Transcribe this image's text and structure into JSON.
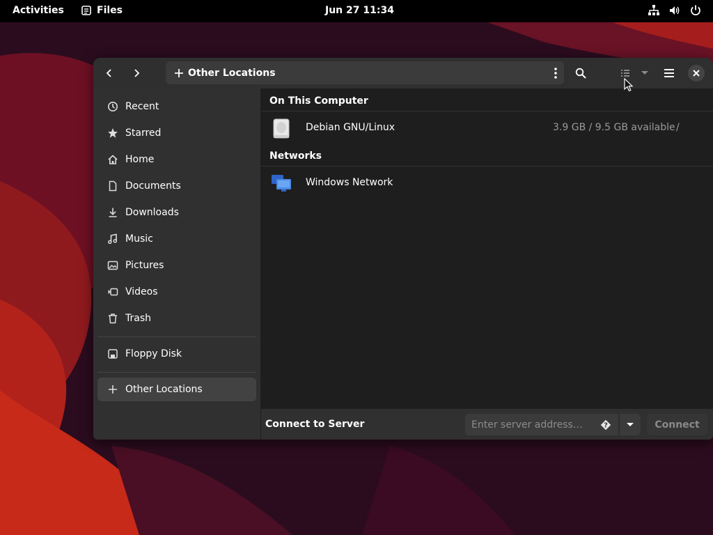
{
  "topbar": {
    "activities": "Activities",
    "app_name": "Files",
    "clock": "Jun 27  11:34",
    "icons": [
      "network-icon",
      "volume-icon",
      "power-icon"
    ]
  },
  "window": {
    "path_label": "Other Locations",
    "sidebar": {
      "items": [
        {
          "label": "Recent",
          "icon": "clock-icon"
        },
        {
          "label": "Starred",
          "icon": "star-icon"
        },
        {
          "label": "Home",
          "icon": "home-icon"
        },
        {
          "label": "Documents",
          "icon": "document-icon"
        },
        {
          "label": "Downloads",
          "icon": "download-icon"
        },
        {
          "label": "Music",
          "icon": "music-icon"
        },
        {
          "label": "Pictures",
          "icon": "picture-icon"
        },
        {
          "label": "Videos",
          "icon": "video-icon"
        },
        {
          "label": "Trash",
          "icon": "trash-icon"
        }
      ],
      "devices": [
        {
          "label": "Floppy Disk",
          "icon": "floppy-icon"
        }
      ],
      "other": {
        "label": "Other Locations",
        "icon": "plus-icon",
        "active": true
      }
    },
    "sections": {
      "computer": {
        "title": "On This Computer",
        "items": [
          {
            "name": "Debian GNU/Linux",
            "availability": "3.9 GB / 9.5 GB available",
            "mount": "/",
            "icon": "drive-icon"
          }
        ]
      },
      "networks": {
        "title": "Networks",
        "items": [
          {
            "name": "Windows Network",
            "icon": "windows-network-icon"
          }
        ]
      }
    },
    "connect": {
      "label": "Connect to Server",
      "placeholder": "Enter server address…",
      "value": "",
      "button": "Connect"
    }
  },
  "colors": {
    "topbar": "#000000",
    "window_bg": "#242424",
    "sidebar_bg": "#303030",
    "accent_wallpaper": "#c0201c"
  }
}
